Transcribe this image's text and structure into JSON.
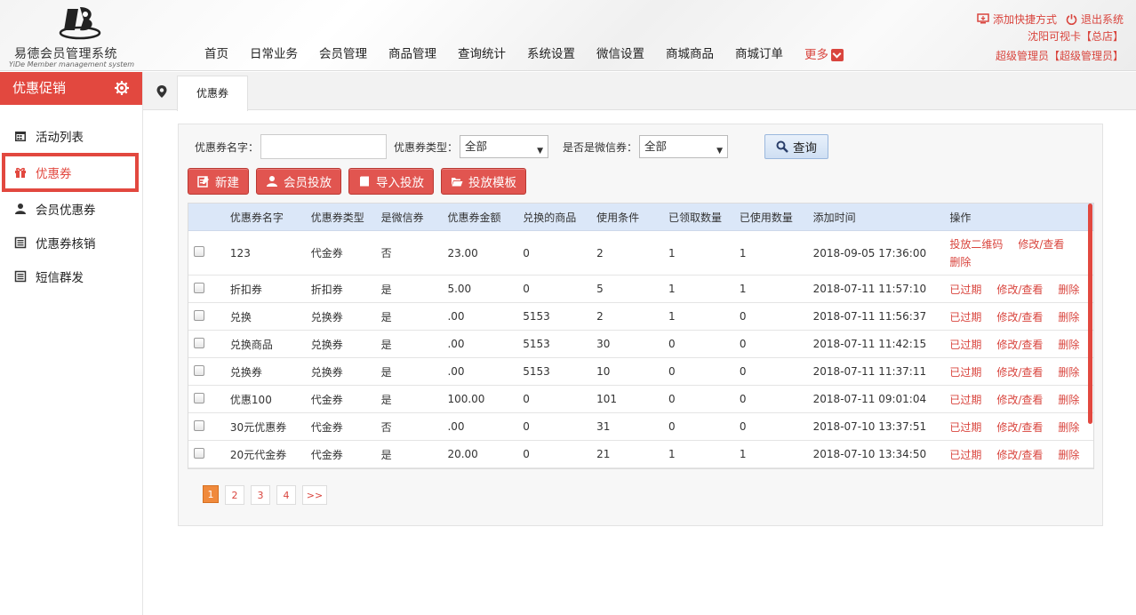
{
  "brand": {
    "title": "易德会员管理系统",
    "subtitle": "YiDe Member management system"
  },
  "nav": [
    {
      "label": "首页"
    },
    {
      "label": "日常业务"
    },
    {
      "label": "会员管理"
    },
    {
      "label": "商品管理"
    },
    {
      "label": "查询统计"
    },
    {
      "label": "系统设置"
    },
    {
      "label": "微信设置"
    },
    {
      "label": "商城商品"
    },
    {
      "label": "商城订单"
    }
  ],
  "nav_more": "更多",
  "top_right": {
    "shortcut": "添加快捷方式",
    "logout": "退出系统",
    "store": "沈阳可视卡【总店】",
    "user": "超级管理员【超级管理员】"
  },
  "sidebar": {
    "title": "优惠促销",
    "items": [
      {
        "label": "活动列表",
        "icon": "calendar-icon"
      },
      {
        "label": "优惠券",
        "icon": "gift-icon"
      },
      {
        "label": "会员优惠券",
        "icon": "user-icon"
      },
      {
        "label": "优惠券核销",
        "icon": "list-icon"
      },
      {
        "label": "短信群发",
        "icon": "list-icon"
      }
    ]
  },
  "tab": {
    "label": "优惠券"
  },
  "filter": {
    "name_label": "优惠券名字：",
    "name_value": "",
    "type_label": "优惠券类型：",
    "type_value": "全部",
    "wechat_label": "是否是微信券：",
    "wechat_value": "全部",
    "query": "查询"
  },
  "buttons": {
    "new": "新建",
    "member_issue": "会员投放",
    "import_issue": "导入投放",
    "template": "投放模板"
  },
  "table": {
    "headers": [
      "优惠券名字",
      "优惠券类型",
      "是微信券",
      "优惠券金额",
      "兑换的商品",
      "使用条件",
      "已领取数量",
      "已使用数量",
      "添加时间",
      "操作"
    ],
    "rows": [
      {
        "name": "123",
        "type": "代金券",
        "wechat": "否",
        "amount": "23.00",
        "goods": "0",
        "cond": "2",
        "got": "1",
        "used": "1",
        "time": "2018-09-05 17:36:00",
        "op1": "投放二维码",
        "op2": "修改/查看",
        "op3": "删除"
      },
      {
        "name": "折扣券",
        "type": "折扣券",
        "wechat": "是",
        "amount": "5.00",
        "goods": "0",
        "cond": "5",
        "got": "1",
        "used": "1",
        "time": "2018-07-11 11:57:10",
        "op1": "已过期",
        "op2": "修改/查看",
        "op3": "删除"
      },
      {
        "name": "兑换",
        "type": "兑换券",
        "wechat": "是",
        "amount": ".00",
        "goods": "5153",
        "cond": "2",
        "got": "1",
        "used": "0",
        "time": "2018-07-11 11:56:37",
        "op1": "已过期",
        "op2": "修改/查看",
        "op3": "删除"
      },
      {
        "name": "兑换商品",
        "type": "兑换券",
        "wechat": "是",
        "amount": ".00",
        "goods": "5153",
        "cond": "30",
        "got": "0",
        "used": "0",
        "time": "2018-07-11 11:42:15",
        "op1": "已过期",
        "op2": "修改/查看",
        "op3": "删除"
      },
      {
        "name": "兑换券",
        "type": "兑换券",
        "wechat": "是",
        "amount": ".00",
        "goods": "5153",
        "cond": "10",
        "got": "0",
        "used": "0",
        "time": "2018-07-11 11:37:11",
        "op1": "已过期",
        "op2": "修改/查看",
        "op3": "删除"
      },
      {
        "name": "优惠100",
        "type": "代金券",
        "wechat": "是",
        "amount": "100.00",
        "goods": "0",
        "cond": "101",
        "got": "0",
        "used": "0",
        "time": "2018-07-11 09:01:04",
        "op1": "已过期",
        "op2": "修改/查看",
        "op3": "删除"
      },
      {
        "name": "30元优惠券",
        "type": "代金券",
        "wechat": "否",
        "amount": ".00",
        "goods": "0",
        "cond": "31",
        "got": "0",
        "used": "0",
        "time": "2018-07-10 13:37:51",
        "op1": "已过期",
        "op2": "修改/查看",
        "op3": "删除"
      },
      {
        "name": "20元代金券",
        "type": "代金券",
        "wechat": "是",
        "amount": "20.00",
        "goods": "0",
        "cond": "21",
        "got": "1",
        "used": "1",
        "time": "2018-07-10 13:34:50",
        "op1": "已过期",
        "op2": "修改/查看",
        "op3": "删除"
      }
    ]
  },
  "pager": {
    "pages": [
      "1",
      "2",
      "3",
      "4"
    ],
    "current": "1",
    "next": ">>"
  },
  "colors": {
    "accent": "#e2483f",
    "link": "#d9453e",
    "header_row": "#dbe7f8",
    "current_page": "#f08a3c"
  }
}
